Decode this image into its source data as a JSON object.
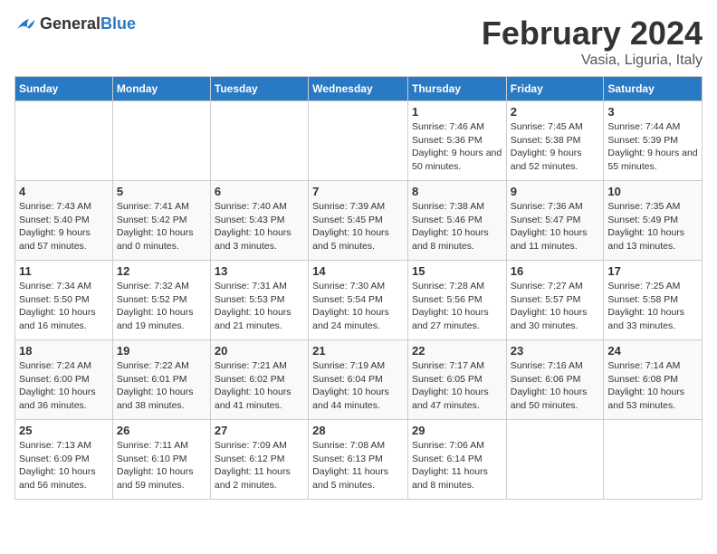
{
  "logo": {
    "general": "General",
    "blue": "Blue"
  },
  "title": "February 2024",
  "subtitle": "Vasia, Liguria, Italy",
  "headers": [
    "Sunday",
    "Monday",
    "Tuesday",
    "Wednesday",
    "Thursday",
    "Friday",
    "Saturday"
  ],
  "weeks": [
    [
      {
        "day": "",
        "info": ""
      },
      {
        "day": "",
        "info": ""
      },
      {
        "day": "",
        "info": ""
      },
      {
        "day": "",
        "info": ""
      },
      {
        "day": "1",
        "info": "Sunrise: 7:46 AM\nSunset: 5:36 PM\nDaylight: 9 hours and 50 minutes."
      },
      {
        "day": "2",
        "info": "Sunrise: 7:45 AM\nSunset: 5:38 PM\nDaylight: 9 hours and 52 minutes."
      },
      {
        "day": "3",
        "info": "Sunrise: 7:44 AM\nSunset: 5:39 PM\nDaylight: 9 hours and 55 minutes."
      }
    ],
    [
      {
        "day": "4",
        "info": "Sunrise: 7:43 AM\nSunset: 5:40 PM\nDaylight: 9 hours and 57 minutes."
      },
      {
        "day": "5",
        "info": "Sunrise: 7:41 AM\nSunset: 5:42 PM\nDaylight: 10 hours and 0 minutes."
      },
      {
        "day": "6",
        "info": "Sunrise: 7:40 AM\nSunset: 5:43 PM\nDaylight: 10 hours and 3 minutes."
      },
      {
        "day": "7",
        "info": "Sunrise: 7:39 AM\nSunset: 5:45 PM\nDaylight: 10 hours and 5 minutes."
      },
      {
        "day": "8",
        "info": "Sunrise: 7:38 AM\nSunset: 5:46 PM\nDaylight: 10 hours and 8 minutes."
      },
      {
        "day": "9",
        "info": "Sunrise: 7:36 AM\nSunset: 5:47 PM\nDaylight: 10 hours and 11 minutes."
      },
      {
        "day": "10",
        "info": "Sunrise: 7:35 AM\nSunset: 5:49 PM\nDaylight: 10 hours and 13 minutes."
      }
    ],
    [
      {
        "day": "11",
        "info": "Sunrise: 7:34 AM\nSunset: 5:50 PM\nDaylight: 10 hours and 16 minutes."
      },
      {
        "day": "12",
        "info": "Sunrise: 7:32 AM\nSunset: 5:52 PM\nDaylight: 10 hours and 19 minutes."
      },
      {
        "day": "13",
        "info": "Sunrise: 7:31 AM\nSunset: 5:53 PM\nDaylight: 10 hours and 21 minutes."
      },
      {
        "day": "14",
        "info": "Sunrise: 7:30 AM\nSunset: 5:54 PM\nDaylight: 10 hours and 24 minutes."
      },
      {
        "day": "15",
        "info": "Sunrise: 7:28 AM\nSunset: 5:56 PM\nDaylight: 10 hours and 27 minutes."
      },
      {
        "day": "16",
        "info": "Sunrise: 7:27 AM\nSunset: 5:57 PM\nDaylight: 10 hours and 30 minutes."
      },
      {
        "day": "17",
        "info": "Sunrise: 7:25 AM\nSunset: 5:58 PM\nDaylight: 10 hours and 33 minutes."
      }
    ],
    [
      {
        "day": "18",
        "info": "Sunrise: 7:24 AM\nSunset: 6:00 PM\nDaylight: 10 hours and 36 minutes."
      },
      {
        "day": "19",
        "info": "Sunrise: 7:22 AM\nSunset: 6:01 PM\nDaylight: 10 hours and 38 minutes."
      },
      {
        "day": "20",
        "info": "Sunrise: 7:21 AM\nSunset: 6:02 PM\nDaylight: 10 hours and 41 minutes."
      },
      {
        "day": "21",
        "info": "Sunrise: 7:19 AM\nSunset: 6:04 PM\nDaylight: 10 hours and 44 minutes."
      },
      {
        "day": "22",
        "info": "Sunrise: 7:17 AM\nSunset: 6:05 PM\nDaylight: 10 hours and 47 minutes."
      },
      {
        "day": "23",
        "info": "Sunrise: 7:16 AM\nSunset: 6:06 PM\nDaylight: 10 hours and 50 minutes."
      },
      {
        "day": "24",
        "info": "Sunrise: 7:14 AM\nSunset: 6:08 PM\nDaylight: 10 hours and 53 minutes."
      }
    ],
    [
      {
        "day": "25",
        "info": "Sunrise: 7:13 AM\nSunset: 6:09 PM\nDaylight: 10 hours and 56 minutes."
      },
      {
        "day": "26",
        "info": "Sunrise: 7:11 AM\nSunset: 6:10 PM\nDaylight: 10 hours and 59 minutes."
      },
      {
        "day": "27",
        "info": "Sunrise: 7:09 AM\nSunset: 6:12 PM\nDaylight: 11 hours and 2 minutes."
      },
      {
        "day": "28",
        "info": "Sunrise: 7:08 AM\nSunset: 6:13 PM\nDaylight: 11 hours and 5 minutes."
      },
      {
        "day": "29",
        "info": "Sunrise: 7:06 AM\nSunset: 6:14 PM\nDaylight: 11 hours and 8 minutes."
      },
      {
        "day": "",
        "info": ""
      },
      {
        "day": "",
        "info": ""
      }
    ]
  ]
}
